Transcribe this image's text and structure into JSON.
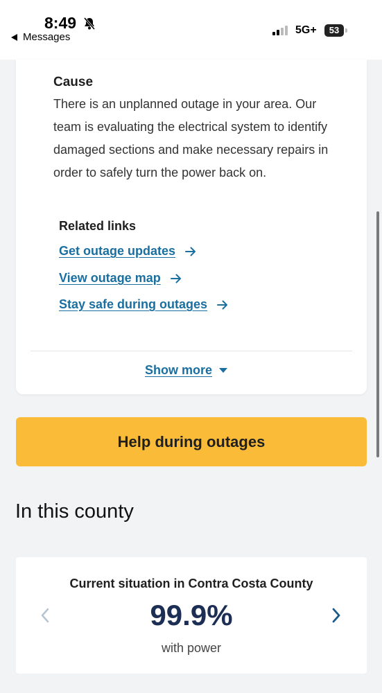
{
  "status_bar": {
    "time": "8:49",
    "back_label": "Messages",
    "network": "5G+",
    "battery": "53"
  },
  "outage_card": {
    "cause_title": "Cause",
    "cause_text": "There is an unplanned outage in your area. Our team is evaluating the electrical system to identify damaged sections and make necessary repairs in order to safely turn the power back on.",
    "related_title": "Related links",
    "links": [
      {
        "label": "Get outage updates"
      },
      {
        "label": "View outage map"
      },
      {
        "label": "Stay safe during outages"
      }
    ],
    "show_more_label": "Show more"
  },
  "help_button": {
    "label": "Help during outages"
  },
  "county_section": {
    "heading": "In this county",
    "situation": {
      "title": "Current situation in Contra Costa County",
      "value": "99.9%",
      "caption": "with power"
    }
  },
  "colors": {
    "accent_link": "#1a6fa0",
    "button_yellow": "#f9bb38",
    "value_navy": "#1c2e54"
  },
  "icons": [
    "silent-bell-icon",
    "back-arrow-icon",
    "signal-icon",
    "battery-icon",
    "arrow-right-icon",
    "caret-down-icon",
    "chevron-left-icon",
    "chevron-right-icon"
  ]
}
